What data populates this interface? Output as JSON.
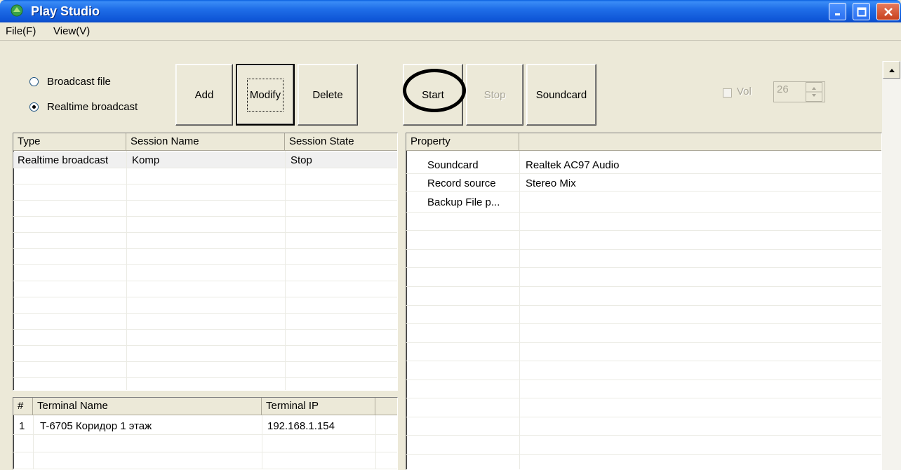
{
  "window": {
    "title": "Play Studio"
  },
  "menu": {
    "items": [
      "File(F)",
      "View(V)"
    ]
  },
  "toolbar": {
    "radio_broadcast_file": "Broadcast file",
    "radio_realtime": "Realtime broadcast",
    "add_label": "Add",
    "modify_label": "Modify",
    "delete_label": "Delete",
    "start_label": "Start",
    "stop_label": "Stop",
    "soundcard_label": "Soundcard",
    "vol_label": "Vol",
    "vol_value": "26"
  },
  "sessions": {
    "columns": [
      "Type",
      "Session Name",
      "Session State"
    ],
    "rows": [
      {
        "type": "Realtime broadcast",
        "name": "Komp",
        "state": "Stop"
      }
    ]
  },
  "terminals": {
    "columns": [
      "#",
      "Terminal Name",
      "Terminal IP"
    ],
    "rows": [
      {
        "num": "1",
        "name": "T-6705 Коридор 1 этаж",
        "ip": "192.168.1.154"
      }
    ]
  },
  "properties": {
    "columns": [
      "Property",
      ""
    ],
    "rows": [
      {
        "name": "Soundcard",
        "value": "Realtek AC97 Audio"
      },
      {
        "name": "Record source",
        "value": "Stereo Mix"
      },
      {
        "name": "Backup File p...",
        "value": ""
      }
    ]
  }
}
